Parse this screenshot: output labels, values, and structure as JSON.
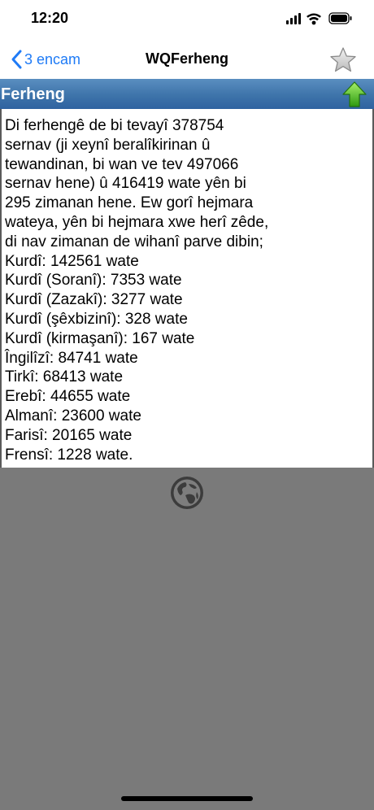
{
  "status_bar": {
    "time": "12:20",
    "icons": [
      "cellular-signal-icon",
      "wifi-icon",
      "battery-icon"
    ]
  },
  "nav": {
    "back_label": "3 encam",
    "title": "WQFerheng",
    "right_icon": "star-icon",
    "accent_color": "#1f7bf6"
  },
  "section": {
    "title": "Ferheng",
    "right_icon": "green-up-arrow-icon",
    "bar_color": "#3e74aa"
  },
  "content": {
    "intro": "Di ferhengê de bi tevayî 378754\nsernav (ji xeynî beralîkirinan û\ntewandinan, bi wan ve tev 497066\nsernav hene) û 416419 wate yên bi\n295 zimanan hene. Ew gorî hejmara\nwateya, yên bi hejmara xwe herî zêde,\ndi nav zimanan de wihanî parve dibin;",
    "languages": [
      "Kurdî: 142561 wate",
      "Kurdî (Soranî): 7353 wate",
      "Kurdî (Zazakî): 3277 wate",
      "Kurdî (şêxbizinî): 328 wate",
      "Kurdî (kirmaşanî): 167 wate",
      "Îngilîzî: 84741 wate",
      "Tirkî: 68413 wate",
      "Erebî: 44655 wate",
      "Almanî: 23600 wate",
      "Farisî: 20165 wate",
      "Frensî: 1228 wate."
    ]
  },
  "footer": {
    "icon": "globe-icon"
  }
}
